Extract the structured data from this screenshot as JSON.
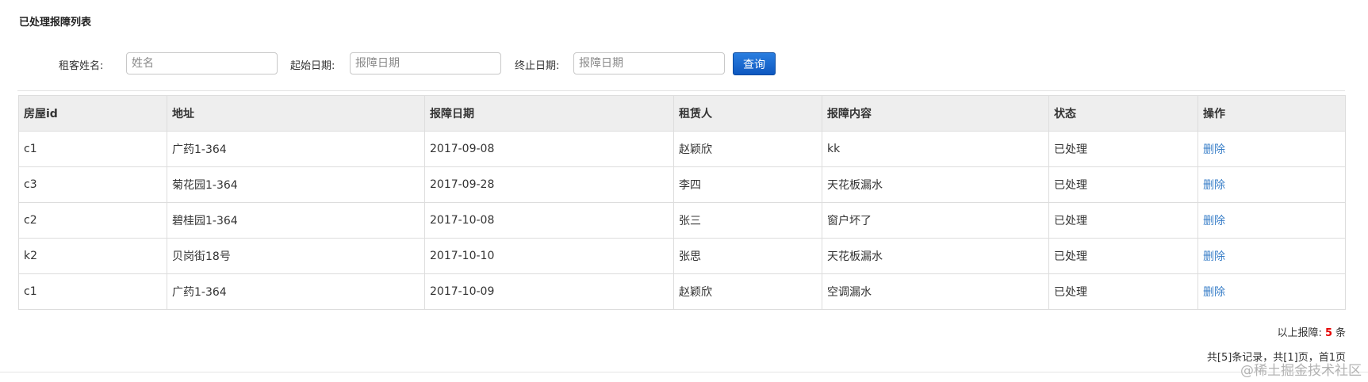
{
  "page": {
    "title": "已处理报障列表"
  },
  "filters": {
    "name_label": "租客姓名:",
    "name_placeholder": "姓名",
    "start_label": "起始日期:",
    "start_placeholder": "报障日期",
    "end_label": "终止日期:",
    "end_placeholder": "报障日期",
    "query_label": "查询"
  },
  "table": {
    "headers": [
      "房屋id",
      "地址",
      "报障日期",
      "租赁人",
      "报障内容",
      "状态",
      "操作"
    ],
    "rows": [
      {
        "house_id": "c1",
        "address": "广药1-364",
        "date": "2017-09-08",
        "tenant": "赵颖欣",
        "content": "kk",
        "status": "已处理",
        "action": "删除"
      },
      {
        "house_id": "c3",
        "address": "菊花园1-364",
        "date": "2017-09-28",
        "tenant": "李四",
        "content": "天花板漏水",
        "status": "已处理",
        "action": "删除"
      },
      {
        "house_id": "c2",
        "address": "碧桂园1-364",
        "date": "2017-10-08",
        "tenant": "张三",
        "content": "窗户坏了",
        "status": "已处理",
        "action": "删除"
      },
      {
        "house_id": "k2",
        "address": "贝岗街18号",
        "date": "2017-10-10",
        "tenant": "张思",
        "content": "天花板漏水",
        "status": "已处理",
        "action": "删除"
      },
      {
        "house_id": "c1",
        "address": "广药1-364",
        "date": "2017-10-09",
        "tenant": "赵颖欣",
        "content": "空调漏水",
        "status": "已处理",
        "action": "删除"
      }
    ]
  },
  "summary": {
    "prefix": "以上报障:",
    "count": "5",
    "suffix": "条"
  },
  "pager": {
    "text": "共[5]条记录，共[1]页，首1页"
  },
  "watermark": {
    "text": "@稀土掘金技术社区"
  },
  "colors": {
    "accent": "#1a66d0",
    "link": "#3a7fc8",
    "count": "#e60000"
  }
}
